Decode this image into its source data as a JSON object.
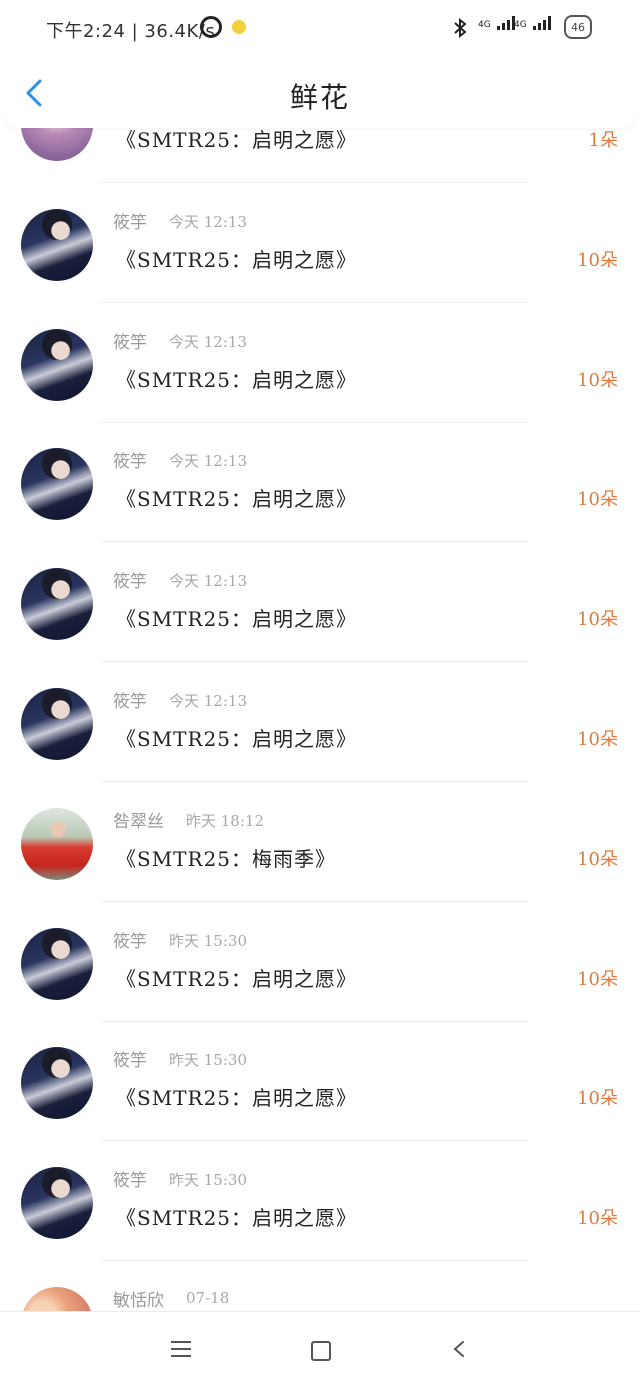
{
  "status_bar": {
    "time_speed": "下午2:24 | 36.4K/s",
    "network_1": "4G",
    "network_2": "4G",
    "battery": "46"
  },
  "header": {
    "title": "鲜花"
  },
  "list": {
    "items": [
      {
        "name": "",
        "time": "",
        "gift": "《SMTR25：启明之愿》",
        "count": "1朵",
        "avatar": "purple"
      },
      {
        "name": "筱竽",
        "time": "今天 12:13",
        "gift": "《SMTR25：启明之愿》",
        "count": "10朵",
        "avatar": "person"
      },
      {
        "name": "筱竽",
        "time": "今天 12:13",
        "gift": "《SMTR25：启明之愿》",
        "count": "10朵",
        "avatar": "person"
      },
      {
        "name": "筱竽",
        "time": "今天 12:13",
        "gift": "《SMTR25：启明之愿》",
        "count": "10朵",
        "avatar": "person"
      },
      {
        "name": "筱竽",
        "time": "今天 12:13",
        "gift": "《SMTR25：启明之愿》",
        "count": "10朵",
        "avatar": "person"
      },
      {
        "name": "筱竽",
        "time": "今天 12:13",
        "gift": "《SMTR25：启明之愿》",
        "count": "10朵",
        "avatar": "person"
      },
      {
        "name": "咎翠丝",
        "time": "昨天 18:12",
        "gift": "《SMTR25：梅雨季》",
        "count": "10朵",
        "avatar": "red"
      },
      {
        "name": "筱竽",
        "time": "昨天 15:30",
        "gift": "《SMTR25：启明之愿》",
        "count": "10朵",
        "avatar": "person"
      },
      {
        "name": "筱竽",
        "time": "昨天 15:30",
        "gift": "《SMTR25：启明之愿》",
        "count": "10朵",
        "avatar": "person"
      },
      {
        "name": "筱竽",
        "time": "昨天 15:30",
        "gift": "《SMTR25：启明之愿》",
        "count": "10朵",
        "avatar": "person"
      },
      {
        "name": "敏恬欣",
        "time": "07-18",
        "gift": "",
        "count": "",
        "avatar": "bokeh"
      }
    ]
  }
}
